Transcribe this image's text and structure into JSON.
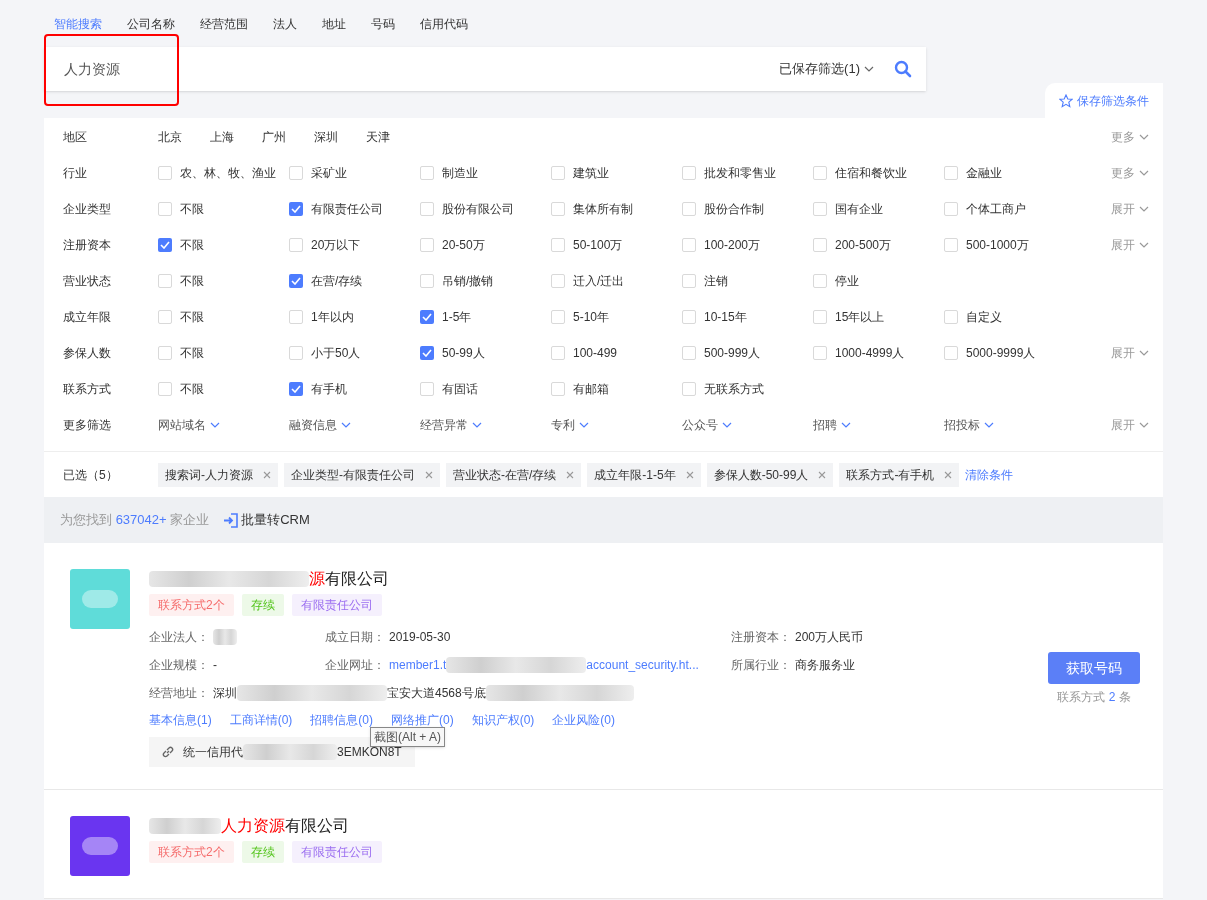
{
  "search_tabs": [
    {
      "label": "智能搜索",
      "selected": true
    },
    {
      "label": "公司名称",
      "selected": false
    },
    {
      "label": "经营范围",
      "selected": false
    },
    {
      "label": "法人",
      "selected": false
    },
    {
      "label": "地址",
      "selected": false
    },
    {
      "label": "号码",
      "selected": false
    },
    {
      "label": "信用代码",
      "selected": false
    }
  ],
  "search": {
    "value": "人力资源",
    "saved_filters": "已保存筛选(1)",
    "highlight_frame": true
  },
  "save_filter_link": "保存筛选条件",
  "filters": [
    {
      "kind": "links",
      "label": "地区",
      "options": [
        {
          "label": "北京"
        },
        {
          "label": "上海"
        },
        {
          "label": "广州"
        },
        {
          "label": "深圳"
        },
        {
          "label": "天津"
        }
      ],
      "more": "更多"
    },
    {
      "kind": "checkbox",
      "label": "行业",
      "options": [
        {
          "label": "农、林、牧、渔业",
          "checked": false
        },
        {
          "label": "采矿业",
          "checked": false
        },
        {
          "label": "制造业",
          "checked": false
        },
        {
          "label": "建筑业",
          "checked": false
        },
        {
          "label": "批发和零售业",
          "checked": false
        },
        {
          "label": "住宿和餐饮业",
          "checked": false
        },
        {
          "label": "金融业",
          "checked": false
        }
      ],
      "more": "更多"
    },
    {
      "kind": "checkbox",
      "label": "企业类型",
      "options": [
        {
          "label": "不限",
          "checked": false
        },
        {
          "label": "有限责任公司",
          "checked": true
        },
        {
          "label": "股份有限公司",
          "checked": false
        },
        {
          "label": "集体所有制",
          "checked": false
        },
        {
          "label": "股份合作制",
          "checked": false
        },
        {
          "label": "国有企业",
          "checked": false
        },
        {
          "label": "个体工商户",
          "checked": false
        }
      ],
      "more": "展开"
    },
    {
      "kind": "checkbox",
      "label": "注册资本",
      "options": [
        {
          "label": "不限",
          "checked": true
        },
        {
          "label": "20万以下",
          "checked": false
        },
        {
          "label": "20-50万",
          "checked": false
        },
        {
          "label": "50-100万",
          "checked": false
        },
        {
          "label": "100-200万",
          "checked": false
        },
        {
          "label": "200-500万",
          "checked": false
        },
        {
          "label": "500-1000万",
          "checked": false
        }
      ],
      "more": "展开"
    },
    {
      "kind": "checkbox",
      "label": "营业状态",
      "options": [
        {
          "label": "不限",
          "checked": false
        },
        {
          "label": "在营/存续",
          "checked": true
        },
        {
          "label": "吊销/撤销",
          "checked": false
        },
        {
          "label": "迁入/迁出",
          "checked": false
        },
        {
          "label": "注销",
          "checked": false
        },
        {
          "label": "停业",
          "checked": false
        }
      ]
    },
    {
      "kind": "checkbox",
      "label": "成立年限",
      "options": [
        {
          "label": "不限",
          "checked": false
        },
        {
          "label": "1年以内",
          "checked": false
        },
        {
          "label": "1-5年",
          "checked": true
        },
        {
          "label": "5-10年",
          "checked": false
        },
        {
          "label": "10-15年",
          "checked": false
        },
        {
          "label": "15年以上",
          "checked": false
        },
        {
          "label": "自定义",
          "checked": false
        }
      ]
    },
    {
      "kind": "checkbox",
      "label": "参保人数",
      "options": [
        {
          "label": "不限",
          "checked": false
        },
        {
          "label": "小于50人",
          "checked": false
        },
        {
          "label": "50-99人",
          "checked": true
        },
        {
          "label": "100-499",
          "checked": false
        },
        {
          "label": "500-999人",
          "checked": false
        },
        {
          "label": "1000-4999人",
          "checked": false
        },
        {
          "label": "5000-9999人",
          "checked": false
        }
      ],
      "more": "展开"
    },
    {
      "kind": "checkbox",
      "label": "联系方式",
      "options": [
        {
          "label": "不限",
          "checked": false
        },
        {
          "label": "有手机",
          "checked": true
        },
        {
          "label": "有固话",
          "checked": false
        },
        {
          "label": "有邮箱",
          "checked": false
        },
        {
          "label": "无联系方式",
          "checked": false
        }
      ]
    },
    {
      "kind": "dropdown",
      "label": "更多筛选",
      "options": [
        {
          "label": "网站域名"
        },
        {
          "label": "融资信息"
        },
        {
          "label": "经营异常"
        },
        {
          "label": "专利"
        },
        {
          "label": "公众号"
        },
        {
          "label": "招聘"
        },
        {
          "label": "招投标"
        }
      ],
      "more": "展开"
    }
  ],
  "selected_bar": {
    "label": "已选（5）",
    "chips": [
      "搜索词-人力资源",
      "企业类型-有限责任公司",
      "营业状态-在营/存续",
      "成立年限-1-5年",
      "参保人数-50-99人",
      "联系方式-有手机"
    ],
    "clear": "清除条件"
  },
  "results_bar": {
    "prefix": "为您找到",
    "count": "637042+",
    "suffix": "家企业",
    "bulk_action": "批量转CRM"
  },
  "results": [
    {
      "color": "#5fdcd9",
      "name": [
        {
          "kind": "blur"
        },
        {
          "kind": "highlight",
          "text": "源"
        },
        {
          "kind": "text",
          "text": "有限公司"
        }
      ],
      "tags": [
        {
          "label": "联系方式2个",
          "color": "#f56c6c"
        },
        {
          "label": "存续",
          "color": "#52c41a"
        },
        {
          "label": "有限责任公司",
          "color": "#9a6cf0"
        }
      ],
      "fields": [
        {
          "label": "企业法人：",
          "parts": [
            {
              "kind": "blur"
            }
          ]
        },
        {
          "label": "成立日期：",
          "parts": [
            {
              "kind": "text",
              "text": "2019-05-30"
            }
          ]
        },
        {
          "label": "注册资本：",
          "parts": [
            {
              "kind": "text",
              "text": "200万人民币"
            }
          ]
        },
        {
          "label": "企业规模：",
          "parts": [
            {
              "kind": "text",
              "text": "-"
            }
          ]
        },
        {
          "label": "企业网址：",
          "parts": [
            {
              "kind": "link",
              "text": "member1.t"
            },
            {
              "kind": "blur"
            },
            {
              "kind": "link",
              "text": "account_security.ht..."
            }
          ]
        },
        {
          "label": "所属行业：",
          "parts": [
            {
              "kind": "text",
              "text": "商务服务业"
            }
          ]
        }
      ],
      "address": {
        "label": "经营地址：",
        "parts": [
          {
            "kind": "text",
            "text": "深圳"
          },
          {
            "kind": "blur"
          },
          {
            "kind": "text",
            "text": "宝安大道4568号底"
          },
          {
            "kind": "blur"
          }
        ]
      },
      "links": [
        "基本信息(1)",
        "工商详情(0)",
        "招聘信息(0)",
        "网络推广(0)",
        "知识产权(0)",
        "企业风险(0)"
      ],
      "credit": {
        "parts": [
          {
            "kind": "text",
            "text": "统一信用代"
          },
          {
            "kind": "blur"
          },
          {
            "kind": "text",
            "text": "3EMKON8T"
          }
        ]
      },
      "tooltip": "截图(Alt + A)",
      "action": "获取号码",
      "contact_note": {
        "prefix": "联系方式",
        "count": "2",
        "suffix": "条"
      }
    },
    {
      "color": "#6a35f0",
      "name": [
        {
          "kind": "blur"
        },
        {
          "kind": "highlight",
          "text": "人力资源"
        },
        {
          "kind": "text",
          "text": "有限公司"
        }
      ],
      "tags": [
        {
          "label": "联系方式2个",
          "color": "#f56c6c"
        },
        {
          "label": "存续",
          "color": "#52c41a"
        },
        {
          "label": "有限责任公司",
          "color": "#9a6cf0"
        }
      ]
    }
  ]
}
